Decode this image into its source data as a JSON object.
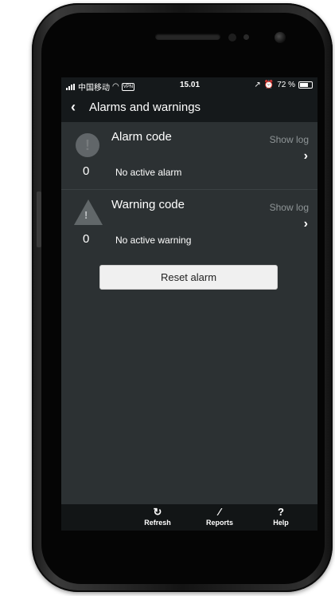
{
  "status_bar": {
    "carrier": "中国移动",
    "time": "15.01",
    "battery": "72 %",
    "battery_level": 0.72,
    "vpn": "VPN"
  },
  "nav": {
    "back_icon": "chevron-left-icon",
    "title": "Alarms and warnings"
  },
  "alarm": {
    "icon": "alarm-circle-icon",
    "title": "Alarm code",
    "count": "0",
    "status": "No active alarm",
    "show_log": "Show log"
  },
  "warning": {
    "icon": "warning-triangle-icon",
    "title": "Warning code",
    "count": "0",
    "status": "No active warning",
    "show_log": "Show log"
  },
  "reset_button": "Reset alarm",
  "tabbar": [
    {
      "label": "Refresh",
      "icon": "refresh-icon"
    },
    {
      "label": "Reports",
      "icon": "pencil-icon"
    },
    {
      "label": "Help",
      "icon": "help-icon"
    }
  ],
  "colors": {
    "screen_bg": "#2c3133",
    "bar_bg": "#15191b",
    "muted_text": "#8f9597"
  }
}
